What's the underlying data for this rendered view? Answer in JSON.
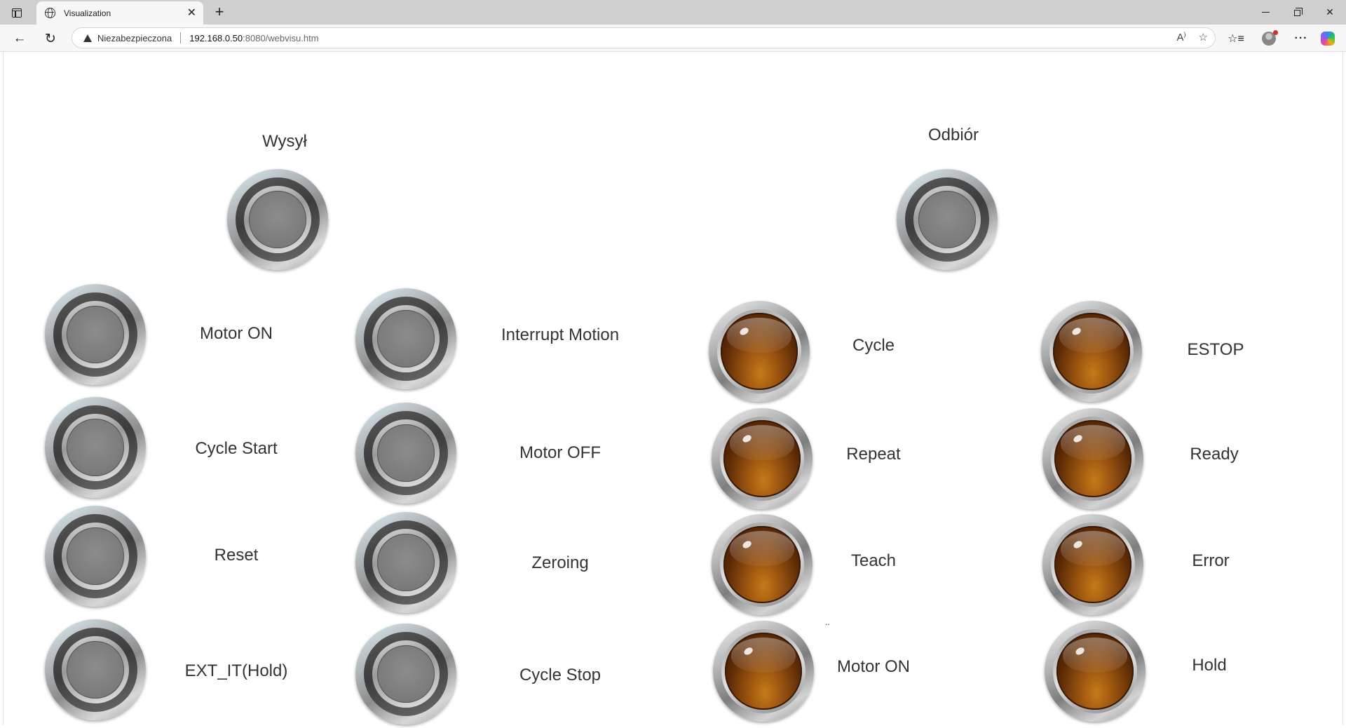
{
  "browser": {
    "tab_title": "Visualization",
    "tab_close": "✕",
    "new_tab": "+",
    "security_warning": "Niezabezpieczona",
    "url_host": "192.168.0.50",
    "url_rest": ":8080/webvisu.htm"
  },
  "page": {
    "send_title": "Wysył",
    "receive_title": "Odbiór",
    "stray_mark": "..",
    "send_buttons": [
      {
        "label": "Motor ON"
      },
      {
        "label": "Cycle Start"
      },
      {
        "label": "Reset"
      },
      {
        "label": "EXT_IT(Hold)"
      },
      {
        "label": "Interrupt Motion"
      },
      {
        "label": "Motor OFF"
      },
      {
        "label": "Zeroing"
      },
      {
        "label": "Cycle Stop"
      }
    ],
    "receive_lamps": [
      {
        "label": "Cycle"
      },
      {
        "label": "Repeat"
      },
      {
        "label": "Teach"
      },
      {
        "label": "Motor ON"
      },
      {
        "label": "ESTOP"
      },
      {
        "label": "Ready"
      },
      {
        "label": "Error"
      },
      {
        "label": "Hold"
      }
    ]
  },
  "colors": {
    "lamp_off": "#5c2a06",
    "button_face": "#8c8c8c"
  }
}
